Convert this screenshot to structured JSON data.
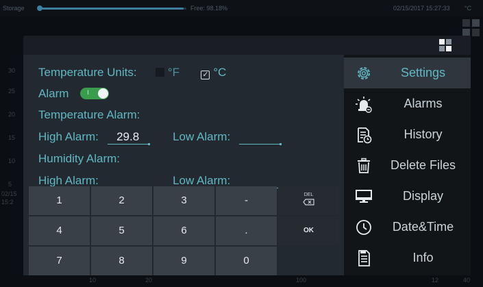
{
  "status": {
    "storage_label": "Storage",
    "storage_fraction": 0.98,
    "free_label": "Free: 98.18%",
    "datetime": "02/15/2017  15:27:33",
    "corner_text": "°C"
  },
  "background": {
    "y_ticks": [
      "30",
      "25",
      "20",
      "15",
      "10",
      "5"
    ],
    "x_ticks": [
      "02/15",
      "15:2",
      "10",
      "20",
      "100",
      "12",
      "40"
    ]
  },
  "form": {
    "temp_units_label": "Temperature Units:",
    "unit_f": "°F",
    "unit_c": "°C",
    "unit_c_checked": true,
    "alarm_label": "Alarm",
    "alarm_on": true,
    "alarm_toggle_mark": "I",
    "temperature_alarm_label": "Temperature Alarm:",
    "temp_high_label": "High Alarm:",
    "temp_high_value": "29.8",
    "temp_low_label": "Low Alarm:",
    "temp_low_value": "",
    "humidity_alarm_label": "Humidity Alarm:",
    "hum_high_label": "High Alarm:",
    "hum_high_value": "",
    "hum_low_label": "Low Alarm:",
    "hum_low_value": ""
  },
  "menu": {
    "items": [
      {
        "label": "Settings",
        "icon": "gear-icon",
        "active": true
      },
      {
        "label": "Alarms",
        "icon": "alarm-light-icon",
        "active": false
      },
      {
        "label": "History",
        "icon": "history-file-icon",
        "active": false
      },
      {
        "label": "Delete Files",
        "icon": "trash-icon",
        "active": false
      },
      {
        "label": "Display",
        "icon": "monitor-icon",
        "active": false
      },
      {
        "label": "Date&Time",
        "icon": "clock-icon",
        "active": false
      },
      {
        "label": "Info",
        "icon": "info-document-icon",
        "active": false
      }
    ]
  },
  "keypad": {
    "row1": [
      "1",
      "2",
      "3",
      "-"
    ],
    "row2": [
      "4",
      "5",
      "6",
      "."
    ],
    "row3": [
      "7",
      "8",
      "9",
      "0"
    ],
    "del_label": "DEL",
    "ok_label": "OK"
  },
  "colors": {
    "accent": "#5fb8c4",
    "toggle_on": "#3a9d4e",
    "panel": "#232930",
    "menu": "#121518",
    "key": "#3a4047"
  }
}
